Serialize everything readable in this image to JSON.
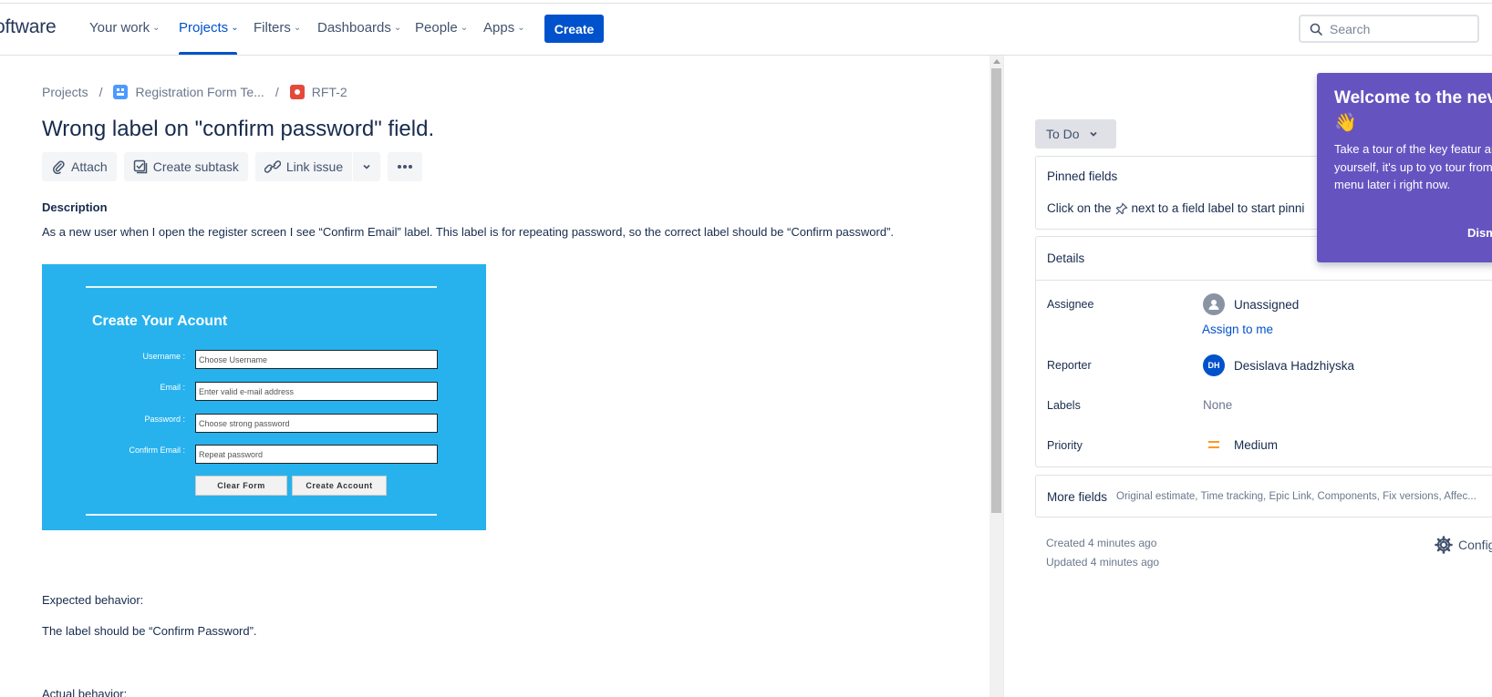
{
  "nav": {
    "brand": "oftware",
    "items": [
      {
        "label": "Your work"
      },
      {
        "label": "Projects"
      },
      {
        "label": "Filters"
      },
      {
        "label": "Dashboards"
      },
      {
        "label": "People"
      },
      {
        "label": "Apps"
      }
    ],
    "create": "Create",
    "search_placeholder": "Search",
    "accent": "#0052cc"
  },
  "breadcrumb": {
    "projects": "Projects",
    "project": "Registration Form Te...",
    "issue_key": "RFT-2"
  },
  "issue": {
    "title": "Wrong label on \"confirm password\" field.",
    "actions": {
      "attach": "Attach",
      "create_subtask": "Create subtask",
      "link_issue": "Link issue"
    },
    "description_heading": "Description",
    "description": "As a new user when I open the register screen I see “Confirm Email” label. This label is for repeating password, so the correct label should be “Confirm password”.",
    "screenshot": {
      "heading": "Create Your Acount",
      "fields": [
        {
          "label": "Username :",
          "placeholder": "Choose Username"
        },
        {
          "label": "Email :",
          "placeholder": "Enter valid e-mail address"
        },
        {
          "label": "Password :",
          "placeholder": "Choose strong password"
        },
        {
          "label": "Confirm Email :",
          "placeholder": "Repeat password"
        }
      ],
      "clear_btn": "Clear Form",
      "create_btn": "Create Account"
    },
    "expected_heading": "Expected behavior:",
    "expected_text": "The label should be “Confirm Password”.",
    "actual_heading": "Actual behavior:"
  },
  "side": {
    "status": "To Do",
    "pinned_title": "Pinned fields",
    "pinned_pre": "Click on the",
    "pinned_post": "next to a field label to start pinni",
    "details_title": "Details",
    "assignee_label": "Assignee",
    "assignee_value": "Unassigned",
    "assign_to_me": "Assign to me",
    "reporter_label": "Reporter",
    "reporter_initials": "DH",
    "reporter_value": "Desislava Hadzhiyska",
    "labels_label": "Labels",
    "labels_value": "None",
    "priority_label": "Priority",
    "priority_value": "Medium",
    "priority_color": "#ff991f",
    "more_title": "More fields",
    "more_subtitle": "Original estimate, Time tracking, Epic Link, Components, Fix versions, Affec...",
    "created": "Created 4 minutes ago",
    "updated": "Updated 4 minutes ago",
    "configure": "Config"
  },
  "spotlight": {
    "heading": "Welcome to the nev",
    "emoji": "👋",
    "body": "Take a tour of the key featur around yourself, it's up to yo tour from the ... menu later i right now.",
    "dismiss": "Dism",
    "color": "#6554c0"
  }
}
